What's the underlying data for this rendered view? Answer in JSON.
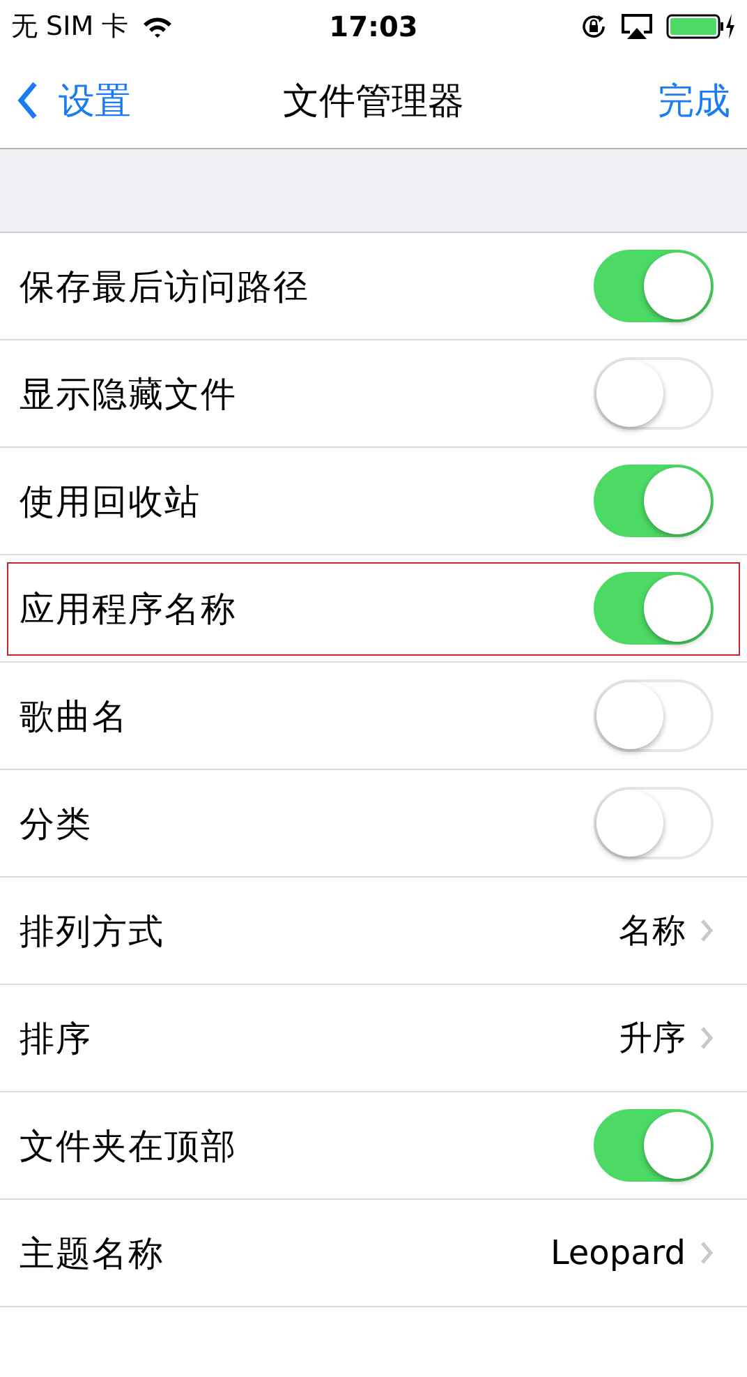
{
  "status_bar": {
    "carrier": "无 SIM 卡",
    "time": "17:03"
  },
  "nav": {
    "back": "设置",
    "title": "文件管理器",
    "done": "完成"
  },
  "rows": [
    {
      "kind": "toggle",
      "label": "保存最后访问路径",
      "on": true,
      "highlighted": false
    },
    {
      "kind": "toggle",
      "label": "显示隐藏文件",
      "on": false,
      "highlighted": false
    },
    {
      "kind": "toggle",
      "label": "使用回收站",
      "on": true,
      "highlighted": false
    },
    {
      "kind": "toggle",
      "label": "应用程序名称",
      "on": true,
      "highlighted": true
    },
    {
      "kind": "toggle",
      "label": "歌曲名",
      "on": false,
      "highlighted": false
    },
    {
      "kind": "toggle",
      "label": "分类",
      "on": false,
      "highlighted": false
    },
    {
      "kind": "value",
      "label": "排列方式",
      "value": "名称",
      "highlighted": false
    },
    {
      "kind": "value",
      "label": "排序",
      "value": "升序",
      "highlighted": false
    },
    {
      "kind": "toggle",
      "label": "文件夹在顶部",
      "on": true,
      "highlighted": false
    },
    {
      "kind": "value",
      "label": "主题名称",
      "value": "Leopard",
      "highlighted": false
    }
  ]
}
